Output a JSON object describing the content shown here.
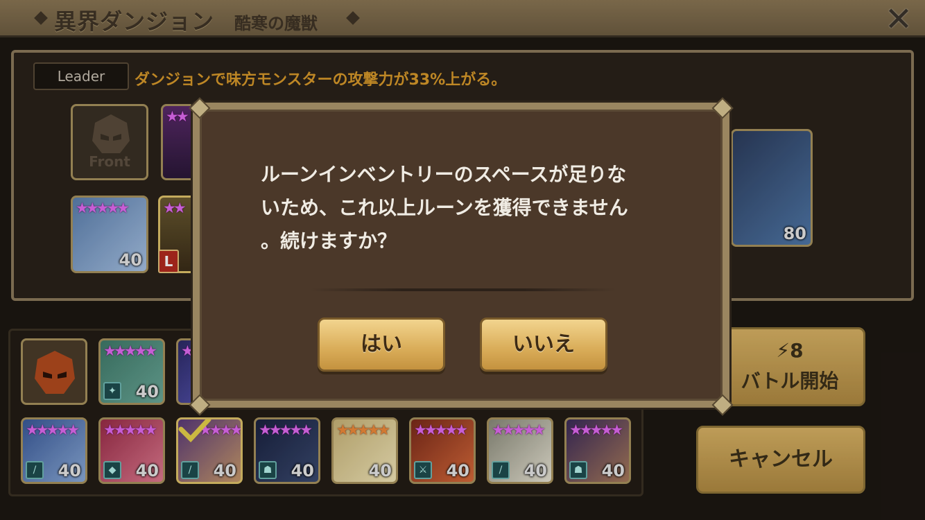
{
  "header": {
    "title": "異界ダンジョン",
    "subtitle": "酷寒の魔獣",
    "close_icon": "close-icon"
  },
  "team": {
    "leader_tag": "Leader",
    "leader_skill_text": "ダンジョンで味方モンスターの攻撃力が33%上がる。",
    "front_label": "Front",
    "boss_level": "80",
    "slots": [
      {
        "stars": "★★★★★",
        "level": "40"
      },
      {
        "stars": "★★",
        "badge": "L"
      }
    ]
  },
  "monster_list": {
    "row1": [
      {
        "stars": "★★★★★",
        "level": "40"
      },
      {
        "stars": "★★★★★",
        "level": ""
      }
    ],
    "row2": [
      {
        "stars": "★★★★★",
        "level": "40"
      },
      {
        "stars": "★★★★★",
        "level": "40"
      },
      {
        "stars": "★★★★★",
        "level": "40"
      },
      {
        "stars": "★★★★★",
        "level": "40"
      },
      {
        "stars": "★★★★★",
        "level": "40"
      },
      {
        "stars": "★★★★★",
        "level": "40"
      },
      {
        "stars": "★★★★★",
        "level": "40"
      },
      {
        "stars": "★★★★★",
        "level": "40"
      }
    ]
  },
  "side_buttons": {
    "energy_cost": "8",
    "battle_start": "バトル開始",
    "cancel": "キャンセル"
  },
  "dialog": {
    "message": "ルーンインベントリーのスペースが足りな\nいため、これ以上ルーンを獲得できません\n。続けますか？",
    "yes": "はい",
    "no": "いいえ"
  },
  "colors": {
    "accent": "#d99a2b",
    "star": "#e26cf2",
    "button": "#d9ac58"
  }
}
